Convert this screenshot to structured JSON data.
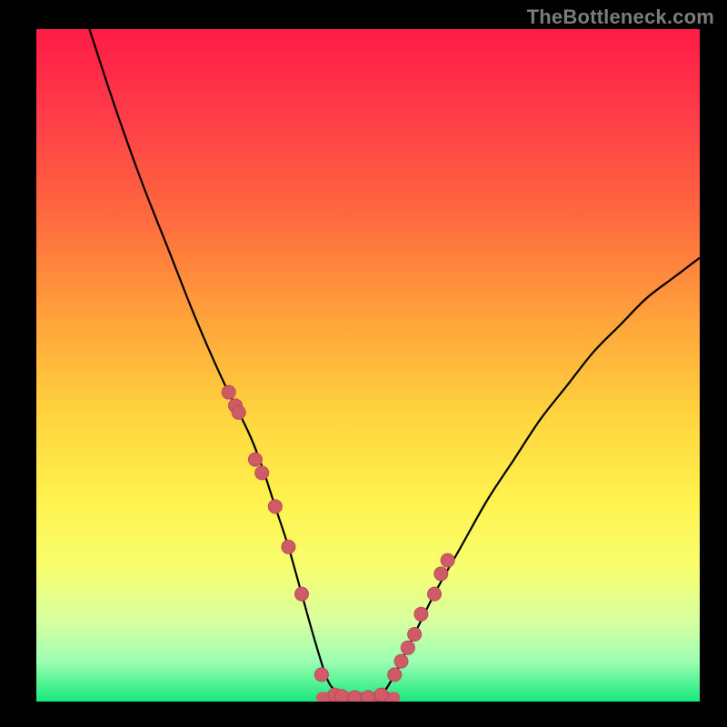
{
  "watermark": "TheBottleneck.com",
  "colors": {
    "background_black": "#000000",
    "curve": "#000000",
    "marker_fill": "#cf5b68",
    "marker_stroke": "#b94b58",
    "gradient_stops": [
      {
        "offset": 0.0,
        "color": "#ff1b45"
      },
      {
        "offset": 0.12,
        "color": "#ff3a49"
      },
      {
        "offset": 0.28,
        "color": "#ff6a3e"
      },
      {
        "offset": 0.44,
        "color": "#ffa63a"
      },
      {
        "offset": 0.58,
        "color": "#ffd63f"
      },
      {
        "offset": 0.7,
        "color": "#fff24e"
      },
      {
        "offset": 0.8,
        "color": "#f7ff6e"
      },
      {
        "offset": 0.88,
        "color": "#d8ffa0"
      },
      {
        "offset": 0.94,
        "color": "#9cffb4"
      },
      {
        "offset": 1.0,
        "color": "#18e87a"
      }
    ]
  },
  "chart_data": {
    "type": "line",
    "title": "",
    "xlabel": "",
    "ylabel": "",
    "xlim": [
      0,
      100
    ],
    "ylim": [
      0,
      100
    ],
    "grid": false,
    "legend": false,
    "series": [
      {
        "name": "bottleneck-curve",
        "x": [
          8,
          12,
          16,
          20,
          24,
          28,
          32,
          34,
          36,
          38,
          40,
          42,
          44,
          46,
          48,
          50,
          52,
          54,
          56,
          60,
          64,
          68,
          72,
          76,
          80,
          84,
          88,
          92,
          96,
          100
        ],
        "y": [
          100,
          88,
          77,
          67,
          57,
          48,
          40,
          35,
          29,
          23,
          16,
          9,
          3,
          1,
          0.5,
          0.5,
          1,
          4,
          8,
          16,
          23,
          30,
          36,
          42,
          47,
          52,
          56,
          60,
          63,
          66
        ]
      }
    ],
    "markers": {
      "name": "highlighted-points",
      "x": [
        29,
        30,
        30.5,
        33,
        34,
        36,
        38,
        40,
        43,
        45,
        46,
        48,
        50,
        52,
        54,
        55,
        56,
        57,
        58,
        60,
        61,
        62
      ],
      "y": [
        46,
        44,
        43,
        36,
        34,
        29,
        23,
        16,
        4,
        1,
        0.8,
        0.6,
        0.6,
        1,
        4,
        6,
        8,
        10,
        13,
        16,
        19,
        21
      ]
    },
    "flat_band": {
      "name": "bottom-band",
      "x": [
        43,
        54
      ],
      "y": 0.6
    }
  }
}
